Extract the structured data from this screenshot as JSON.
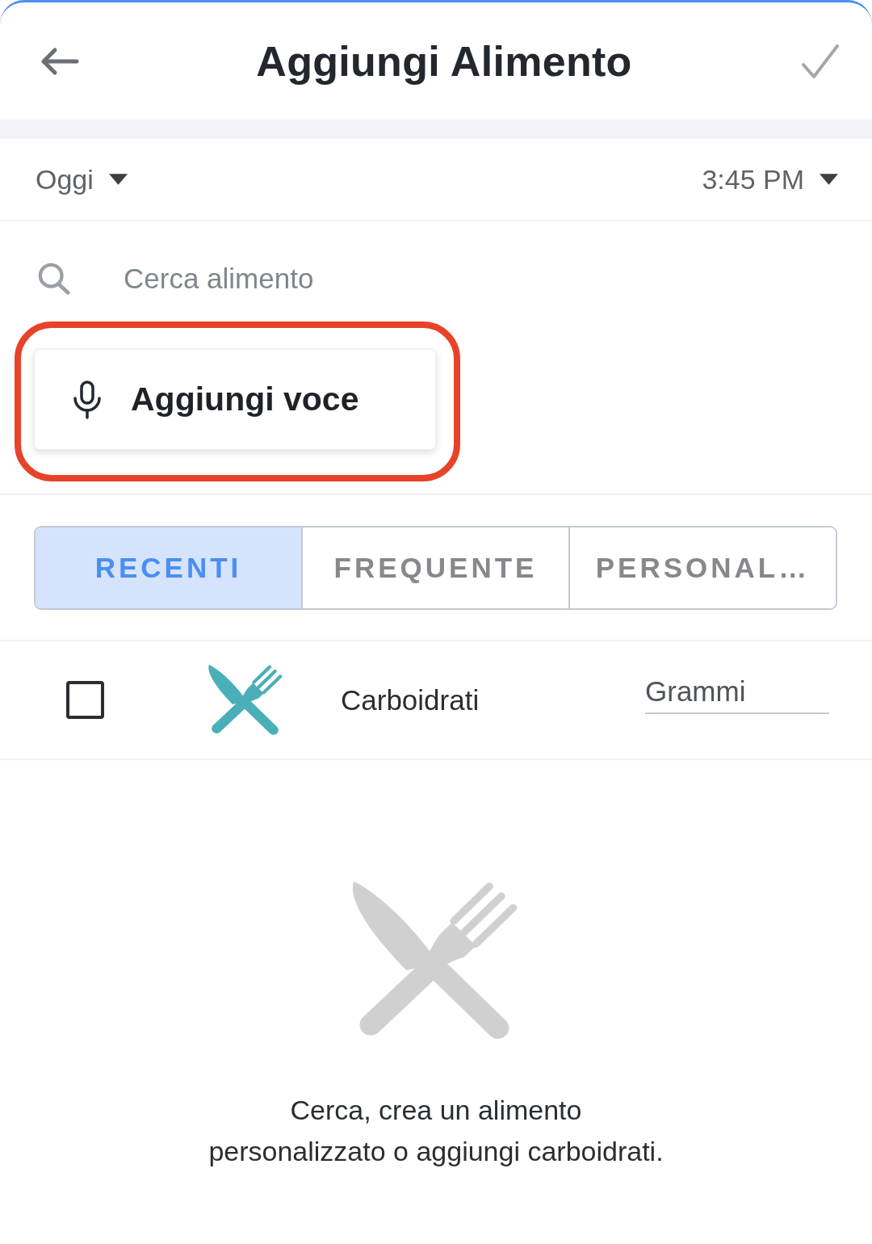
{
  "header": {
    "title": "Aggiungi Alimento"
  },
  "date_time": {
    "date": "Oggi",
    "time": "3:45 PM"
  },
  "search": {
    "placeholder": "Cerca alimento"
  },
  "voice_button": {
    "label": "Aggiungi voce",
    "highlighted": true
  },
  "tabs": [
    {
      "label": "RECENTI",
      "selected": true
    },
    {
      "label": "FREQUENTE",
      "selected": false
    },
    {
      "label": "PERSONAL…",
      "selected": false
    }
  ],
  "food_row": {
    "checked": false,
    "name": "Carboidrati",
    "amount": {
      "placeholder": "Grammi"
    }
  },
  "empty_state": {
    "message": "Cerca, crea un alimento\npersonalizzato o aggiungi carboidrati."
  }
}
